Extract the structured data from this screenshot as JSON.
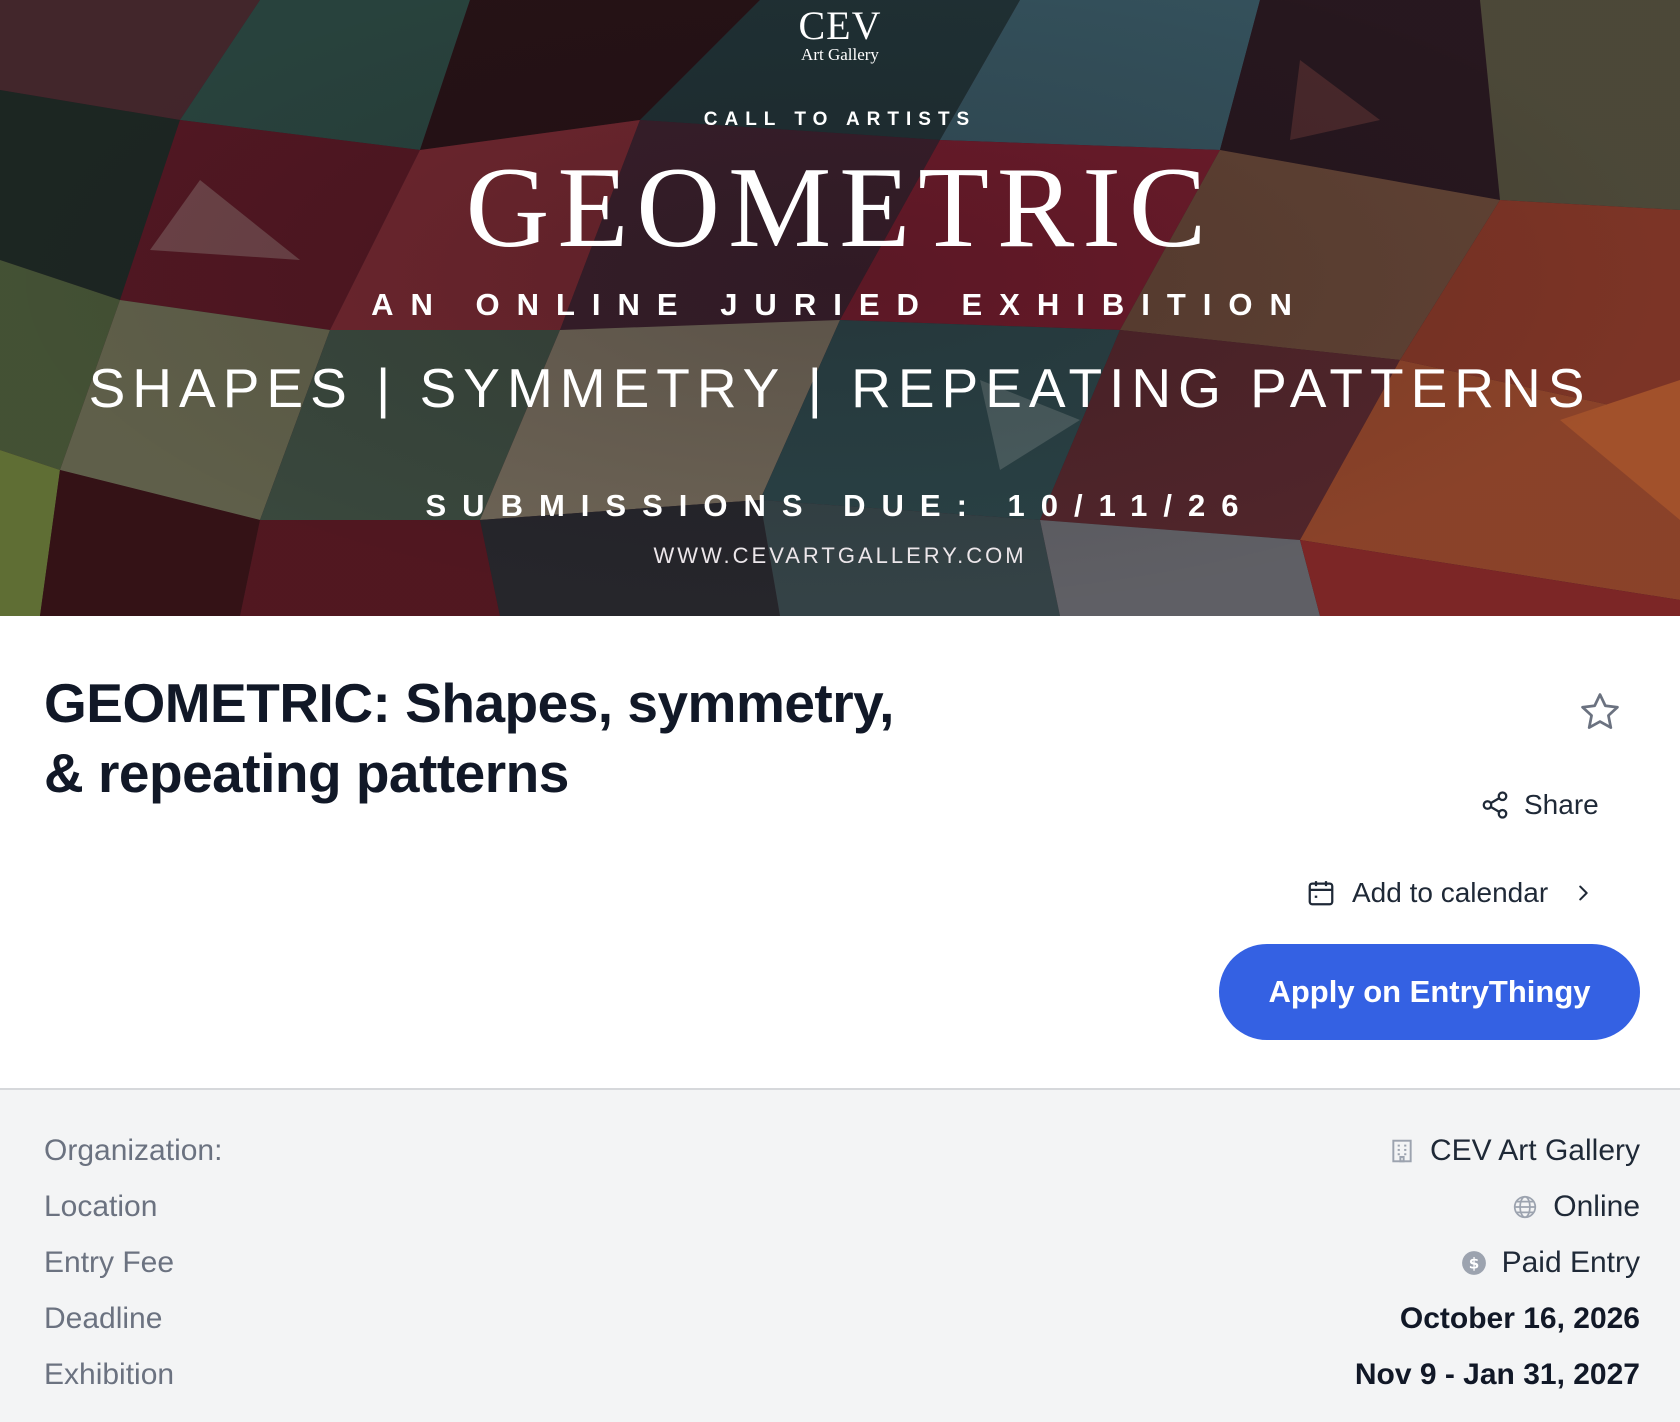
{
  "banner": {
    "logo_main": "CEV",
    "logo_sub": "Art Gallery",
    "call_to_artists": "CALL TO ARTISTS",
    "headline": "GEOMETRIC",
    "subheadline": "AN ONLINE JURIED EXHIBITION",
    "themes": "SHAPES | SYMMETRY | REPEATING PATTERNS",
    "submissions_due": "SUBMISSIONS DUE: 10/11/26",
    "website": "WWW.CEVARTGALLERY.COM"
  },
  "header": {
    "title": "GEOMETRIC: Shapes, symmetry, & repeating patterns",
    "favorite_icon": "star-outline-icon",
    "share_label": "Share",
    "share_icon": "share-icon",
    "calendar_label": "Add to calendar",
    "calendar_icon": "calendar-icon",
    "apply_label": "Apply on EntryThingy",
    "apply_color": "#3461e3"
  },
  "details": [
    {
      "label": "Organization:",
      "value": "CEV Art Gallery",
      "icon": "building-icon",
      "bold": false
    },
    {
      "label": "Location",
      "value": "Online",
      "icon": "globe-icon",
      "bold": false
    },
    {
      "label": "Entry Fee",
      "value": "Paid Entry",
      "icon": "dollar-icon",
      "bold": false
    },
    {
      "label": "Deadline",
      "value": "October 16, 2026",
      "icon": "",
      "bold": true
    },
    {
      "label": "Exhibition",
      "value": "Nov 9 - Jan 31, 2027",
      "icon": "",
      "bold": true
    }
  ]
}
